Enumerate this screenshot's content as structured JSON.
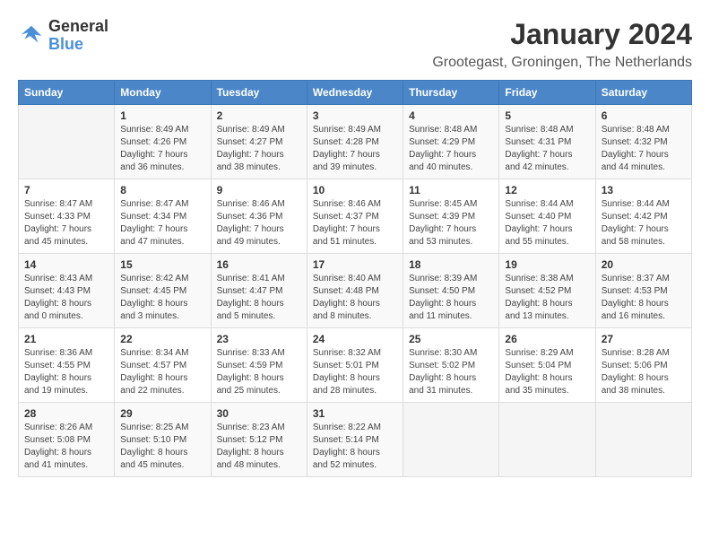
{
  "header": {
    "logo_line1": "General",
    "logo_line2": "Blue",
    "month": "January 2024",
    "location": "Grootegast, Groningen, The Netherlands"
  },
  "weekdays": [
    "Sunday",
    "Monday",
    "Tuesday",
    "Wednesday",
    "Thursday",
    "Friday",
    "Saturday"
  ],
  "weeks": [
    [
      {
        "day": "",
        "info": ""
      },
      {
        "day": "1",
        "info": "Sunrise: 8:49 AM\nSunset: 4:26 PM\nDaylight: 7 hours\nand 36 minutes."
      },
      {
        "day": "2",
        "info": "Sunrise: 8:49 AM\nSunset: 4:27 PM\nDaylight: 7 hours\nand 38 minutes."
      },
      {
        "day": "3",
        "info": "Sunrise: 8:49 AM\nSunset: 4:28 PM\nDaylight: 7 hours\nand 39 minutes."
      },
      {
        "day": "4",
        "info": "Sunrise: 8:48 AM\nSunset: 4:29 PM\nDaylight: 7 hours\nand 40 minutes."
      },
      {
        "day": "5",
        "info": "Sunrise: 8:48 AM\nSunset: 4:31 PM\nDaylight: 7 hours\nand 42 minutes."
      },
      {
        "day": "6",
        "info": "Sunrise: 8:48 AM\nSunset: 4:32 PM\nDaylight: 7 hours\nand 44 minutes."
      }
    ],
    [
      {
        "day": "7",
        "info": "Sunrise: 8:47 AM\nSunset: 4:33 PM\nDaylight: 7 hours\nand 45 minutes."
      },
      {
        "day": "8",
        "info": "Sunrise: 8:47 AM\nSunset: 4:34 PM\nDaylight: 7 hours\nand 47 minutes."
      },
      {
        "day": "9",
        "info": "Sunrise: 8:46 AM\nSunset: 4:36 PM\nDaylight: 7 hours\nand 49 minutes."
      },
      {
        "day": "10",
        "info": "Sunrise: 8:46 AM\nSunset: 4:37 PM\nDaylight: 7 hours\nand 51 minutes."
      },
      {
        "day": "11",
        "info": "Sunrise: 8:45 AM\nSunset: 4:39 PM\nDaylight: 7 hours\nand 53 minutes."
      },
      {
        "day": "12",
        "info": "Sunrise: 8:44 AM\nSunset: 4:40 PM\nDaylight: 7 hours\nand 55 minutes."
      },
      {
        "day": "13",
        "info": "Sunrise: 8:44 AM\nSunset: 4:42 PM\nDaylight: 7 hours\nand 58 minutes."
      }
    ],
    [
      {
        "day": "14",
        "info": "Sunrise: 8:43 AM\nSunset: 4:43 PM\nDaylight: 8 hours\nand 0 minutes."
      },
      {
        "day": "15",
        "info": "Sunrise: 8:42 AM\nSunset: 4:45 PM\nDaylight: 8 hours\nand 3 minutes."
      },
      {
        "day": "16",
        "info": "Sunrise: 8:41 AM\nSunset: 4:47 PM\nDaylight: 8 hours\nand 5 minutes."
      },
      {
        "day": "17",
        "info": "Sunrise: 8:40 AM\nSunset: 4:48 PM\nDaylight: 8 hours\nand 8 minutes."
      },
      {
        "day": "18",
        "info": "Sunrise: 8:39 AM\nSunset: 4:50 PM\nDaylight: 8 hours\nand 11 minutes."
      },
      {
        "day": "19",
        "info": "Sunrise: 8:38 AM\nSunset: 4:52 PM\nDaylight: 8 hours\nand 13 minutes."
      },
      {
        "day": "20",
        "info": "Sunrise: 8:37 AM\nSunset: 4:53 PM\nDaylight: 8 hours\nand 16 minutes."
      }
    ],
    [
      {
        "day": "21",
        "info": "Sunrise: 8:36 AM\nSunset: 4:55 PM\nDaylight: 8 hours\nand 19 minutes."
      },
      {
        "day": "22",
        "info": "Sunrise: 8:34 AM\nSunset: 4:57 PM\nDaylight: 8 hours\nand 22 minutes."
      },
      {
        "day": "23",
        "info": "Sunrise: 8:33 AM\nSunset: 4:59 PM\nDaylight: 8 hours\nand 25 minutes."
      },
      {
        "day": "24",
        "info": "Sunrise: 8:32 AM\nSunset: 5:01 PM\nDaylight: 8 hours\nand 28 minutes."
      },
      {
        "day": "25",
        "info": "Sunrise: 8:30 AM\nSunset: 5:02 PM\nDaylight: 8 hours\nand 31 minutes."
      },
      {
        "day": "26",
        "info": "Sunrise: 8:29 AM\nSunset: 5:04 PM\nDaylight: 8 hours\nand 35 minutes."
      },
      {
        "day": "27",
        "info": "Sunrise: 8:28 AM\nSunset: 5:06 PM\nDaylight: 8 hours\nand 38 minutes."
      }
    ],
    [
      {
        "day": "28",
        "info": "Sunrise: 8:26 AM\nSunset: 5:08 PM\nDaylight: 8 hours\nand 41 minutes."
      },
      {
        "day": "29",
        "info": "Sunrise: 8:25 AM\nSunset: 5:10 PM\nDaylight: 8 hours\nand 45 minutes."
      },
      {
        "day": "30",
        "info": "Sunrise: 8:23 AM\nSunset: 5:12 PM\nDaylight: 8 hours\nand 48 minutes."
      },
      {
        "day": "31",
        "info": "Sunrise: 8:22 AM\nSunset: 5:14 PM\nDaylight: 8 hours\nand 52 minutes."
      },
      {
        "day": "",
        "info": ""
      },
      {
        "day": "",
        "info": ""
      },
      {
        "day": "",
        "info": ""
      }
    ]
  ]
}
